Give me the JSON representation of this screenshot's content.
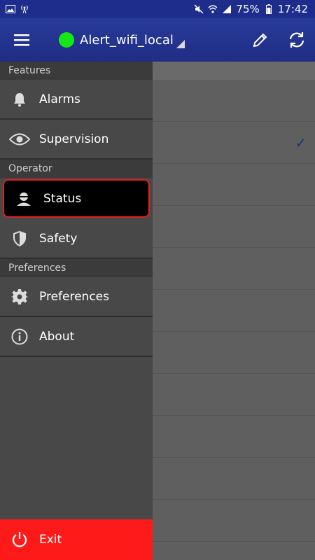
{
  "status_bar": {
    "battery": "75%",
    "time": "17:42",
    "icons": [
      "image-icon",
      "radio-tower-icon",
      "mute-icon",
      "wifi-icon",
      "signal-icon",
      "battery-icon"
    ]
  },
  "app_bar": {
    "connection_name": "Alert_wifi_local",
    "connection_status_color": "#16e816"
  },
  "drawer": {
    "sections": [
      {
        "label": "Features"
      },
      {
        "label": "Operator"
      },
      {
        "label": "Preferences"
      }
    ],
    "items": [
      {
        "label": "Alarms",
        "icon": "bell-icon"
      },
      {
        "label": "Supervision",
        "icon": "eye-icon"
      },
      {
        "label": "Status",
        "icon": "user-icon",
        "selected": true
      },
      {
        "label": "Safety",
        "icon": "shield-icon"
      },
      {
        "label": "Preferences",
        "icon": "gear-icon"
      },
      {
        "label": "About",
        "icon": "info-icon"
      }
    ],
    "exit_label": "Exit"
  },
  "colors": {
    "status_bar": "#1e2d8c",
    "app_bar": "#283a9a",
    "drawer_bg": "#484848",
    "section_bg": "#3b3b3b",
    "selected_border": "#e02020",
    "exit_bg": "#ff1a1a",
    "check": "#1d2f7a"
  }
}
